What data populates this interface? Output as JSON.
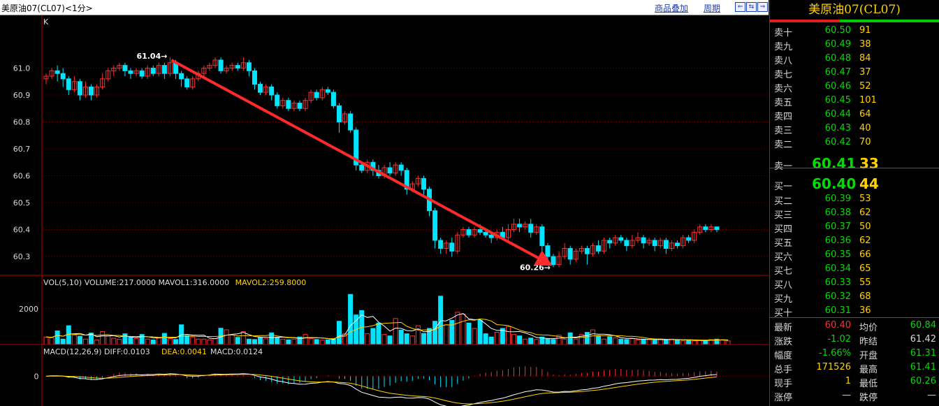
{
  "topbar": {
    "title": "美原油07(CL07)<1分>",
    "overlay_link": "商品叠加",
    "period_link": "周期",
    "nav_buttons": [
      "⇐",
      "⇆",
      "⇒"
    ]
  },
  "chart_data": [
    {
      "type": "candlestick",
      "label": "K",
      "ylim": [
        60.23,
        61.17
      ],
      "yticks": [
        "61.0",
        "60.9",
        "60.8",
        "60.7",
        "60.6",
        "60.5",
        "60.4",
        "60.3"
      ],
      "annotations": [
        {
          "text": "61.04→",
          "value": 61.04
        },
        {
          "text": "60.26→",
          "value": 60.26
        }
      ],
      "candles": [
        [
          60.96,
          60.97,
          60.94,
          60.98
        ],
        [
          60.97,
          60.99,
          60.96,
          61.0
        ],
        [
          60.99,
          60.98,
          60.95,
          61.01
        ],
        [
          60.98,
          60.96,
          60.93,
          61.0
        ],
        [
          60.96,
          60.92,
          60.9,
          60.97
        ],
        [
          60.92,
          60.95,
          60.91,
          60.97
        ],
        [
          60.95,
          60.9,
          60.88,
          60.96
        ],
        [
          60.9,
          60.93,
          60.89,
          60.95
        ],
        [
          60.93,
          60.9,
          60.88,
          60.94
        ],
        [
          60.9,
          60.93,
          60.89,
          60.94
        ],
        [
          60.93,
          60.96,
          60.92,
          60.98
        ],
        [
          60.96,
          60.99,
          60.95,
          61.0
        ],
        [
          60.99,
          61.0,
          60.97,
          61.01
        ],
        [
          61.0,
          61.01,
          60.99,
          61.02
        ],
        [
          61.01,
          60.99,
          60.97,
          61.02
        ],
        [
          60.99,
          60.98,
          60.96,
          61.0
        ],
        [
          60.98,
          60.99,
          60.97,
          61.0
        ],
        [
          60.99,
          60.97,
          60.96,
          61.0
        ],
        [
          60.97,
          61.0,
          60.96,
          61.01
        ],
        [
          61.0,
          60.98,
          60.97,
          61.01
        ],
        [
          60.98,
          61.01,
          60.97,
          61.02
        ],
        [
          61.01,
          60.98,
          60.96,
          61.02
        ],
        [
          60.98,
          61.02,
          60.97,
          61.04
        ],
        [
          61.02,
          60.98,
          60.96,
          61.03
        ],
        [
          60.98,
          60.96,
          60.93,
          60.99
        ],
        [
          60.96,
          60.93,
          60.92,
          60.97
        ],
        [
          60.93,
          60.96,
          60.92,
          60.97
        ],
        [
          60.96,
          60.98,
          60.95,
          60.99
        ],
        [
          60.98,
          61.0,
          60.97,
          61.01
        ],
        [
          61.0,
          61.01,
          60.99,
          61.02
        ],
        [
          61.01,
          61.03,
          61.0,
          61.04
        ],
        [
          61.03,
          60.99,
          60.98,
          61.04
        ],
        [
          60.99,
          61.0,
          60.98,
          61.01
        ],
        [
          61.0,
          61.01,
          60.99,
          61.02
        ],
        [
          61.01,
          61.0,
          60.99,
          61.02
        ],
        [
          61.0,
          61.02,
          60.99,
          61.04
        ],
        [
          61.02,
          60.99,
          60.97,
          61.03
        ],
        [
          60.99,
          60.94,
          60.92,
          61.0
        ],
        [
          60.94,
          60.91,
          60.9,
          60.95
        ],
        [
          60.91,
          60.93,
          60.9,
          60.94
        ],
        [
          60.93,
          60.9,
          60.88,
          60.94
        ],
        [
          60.9,
          60.86,
          60.85,
          60.91
        ],
        [
          60.86,
          60.88,
          60.85,
          60.89
        ],
        [
          60.88,
          60.85,
          60.84,
          60.89
        ],
        [
          60.85,
          60.87,
          60.84,
          60.88
        ],
        [
          60.87,
          60.85,
          60.84,
          60.88
        ],
        [
          60.85,
          60.88,
          60.84,
          60.89
        ],
        [
          60.88,
          60.91,
          60.87,
          60.92
        ],
        [
          60.91,
          60.89,
          60.88,
          60.92
        ],
        [
          60.89,
          60.92,
          60.88,
          60.93
        ],
        [
          60.92,
          60.91,
          60.9,
          60.93
        ],
        [
          60.91,
          60.86,
          60.85,
          60.92
        ],
        [
          60.86,
          60.8,
          60.76,
          60.87
        ],
        [
          60.8,
          60.83,
          60.79,
          60.84
        ],
        [
          60.83,
          60.77,
          60.76,
          60.84
        ],
        [
          60.77,
          60.64,
          60.62,
          60.78
        ],
        [
          60.64,
          60.62,
          60.61,
          60.65
        ],
        [
          60.62,
          60.65,
          60.61,
          60.66
        ],
        [
          60.65,
          60.62,
          60.6,
          60.66
        ],
        [
          60.62,
          60.6,
          60.59,
          60.64
        ],
        [
          60.6,
          60.63,
          60.59,
          60.64
        ],
        [
          60.63,
          60.61,
          60.6,
          60.65
        ],
        [
          60.61,
          60.64,
          60.6,
          60.65
        ],
        [
          60.64,
          60.62,
          60.6,
          60.65
        ],
        [
          60.62,
          60.55,
          60.53,
          60.63
        ],
        [
          60.55,
          60.57,
          60.54,
          60.58
        ],
        [
          60.57,
          60.59,
          60.56,
          60.6
        ],
        [
          60.59,
          60.55,
          60.53,
          60.6
        ],
        [
          60.55,
          60.47,
          60.45,
          60.56
        ],
        [
          60.47,
          60.36,
          60.33,
          60.48
        ],
        [
          60.36,
          60.33,
          60.31,
          60.37
        ],
        [
          60.33,
          60.35,
          60.31,
          60.36
        ],
        [
          60.35,
          60.32,
          60.3,
          60.37
        ],
        [
          60.32,
          60.38,
          60.31,
          60.39
        ],
        [
          60.38,
          60.4,
          60.37,
          60.41
        ],
        [
          60.4,
          60.38,
          60.37,
          60.41
        ],
        [
          60.38,
          60.4,
          60.37,
          60.41
        ],
        [
          60.4,
          60.39,
          60.38,
          60.42
        ],
        [
          60.39,
          60.38,
          60.37,
          60.4
        ],
        [
          60.38,
          60.37,
          60.35,
          60.39
        ],
        [
          60.37,
          60.39,
          60.36,
          60.4
        ],
        [
          60.39,
          60.37,
          60.36,
          60.41
        ],
        [
          60.37,
          60.4,
          60.36,
          60.42
        ],
        [
          60.4,
          60.42,
          60.39,
          60.44
        ],
        [
          60.42,
          60.41,
          60.39,
          60.44
        ],
        [
          60.41,
          60.42,
          60.4,
          60.43
        ],
        [
          60.42,
          60.39,
          60.37,
          60.44
        ],
        [
          60.39,
          60.41,
          60.38,
          60.42
        ],
        [
          60.41,
          60.34,
          60.32,
          60.42
        ],
        [
          60.34,
          60.3,
          60.28,
          60.35
        ],
        [
          60.3,
          60.27,
          60.26,
          60.31
        ],
        [
          60.27,
          60.3,
          60.26,
          60.32
        ],
        [
          60.3,
          60.33,
          60.29,
          60.35
        ],
        [
          60.33,
          60.29,
          60.27,
          60.34
        ],
        [
          60.29,
          60.32,
          60.28,
          60.33
        ],
        [
          60.32,
          60.33,
          60.31,
          60.34
        ],
        [
          60.33,
          60.31,
          60.27,
          60.34
        ],
        [
          60.31,
          60.34,
          60.3,
          60.35
        ],
        [
          60.34,
          60.32,
          60.31,
          60.36
        ],
        [
          60.32,
          60.36,
          60.31,
          60.37
        ],
        [
          60.36,
          60.35,
          60.33,
          60.37
        ],
        [
          60.35,
          60.37,
          60.34,
          60.38
        ],
        [
          60.37,
          60.36,
          60.35,
          60.38
        ],
        [
          60.36,
          60.34,
          60.32,
          60.37
        ],
        [
          60.34,
          60.36,
          60.33,
          60.38
        ],
        [
          60.36,
          60.37,
          60.35,
          60.39
        ],
        [
          60.37,
          60.35,
          60.33,
          60.38
        ],
        [
          60.35,
          60.36,
          60.34,
          60.37
        ],
        [
          60.36,
          60.34,
          60.32,
          60.37
        ],
        [
          60.34,
          60.36,
          60.33,
          60.37
        ],
        [
          60.36,
          60.33,
          60.31,
          60.37
        ],
        [
          60.33,
          60.35,
          60.32,
          60.36
        ],
        [
          60.35,
          60.34,
          60.33,
          60.36
        ],
        [
          60.34,
          60.37,
          60.33,
          60.38
        ],
        [
          60.37,
          60.36,
          60.35,
          60.38
        ],
        [
          60.36,
          60.39,
          60.35,
          60.4
        ],
        [
          60.39,
          60.41,
          60.38,
          60.42
        ],
        [
          60.41,
          60.4,
          60.39,
          60.42
        ],
        [
          60.4,
          60.41,
          60.39,
          60.42
        ],
        [
          60.41,
          60.4,
          60.39,
          60.41
        ]
      ]
    },
    {
      "type": "bar",
      "label": "VOL(5,10)",
      "header": [
        {
          "text": "VOL(5,10) VOLUME:217.0000 MAVOL1:316.0000",
          "color": "#dddddd"
        },
        {
          "text": "MAVOL2:259.8000",
          "color": "#ffd200"
        }
      ],
      "yticks": [
        "2000"
      ],
      "ylim": [
        0,
        3200
      ],
      "values": [
        420,
        380,
        760,
        300,
        1050,
        520,
        460,
        300,
        640,
        260,
        720,
        480,
        350,
        290,
        600,
        410,
        330,
        560,
        300,
        250,
        380,
        620,
        330,
        280,
        1100,
        500,
        420,
        300,
        300,
        260,
        330,
        910,
        820,
        520,
        400,
        720,
        300,
        280,
        410,
        320,
        650,
        380,
        300,
        260,
        300,
        420,
        560,
        320,
        280,
        240,
        260,
        300,
        1300,
        600,
        2800,
        1650,
        1900,
        600,
        900,
        1200,
        560,
        480,
        1450,
        800,
        600,
        480,
        1050,
        620,
        900,
        1300,
        2700,
        1100,
        1350,
        1800,
        1700,
        1200,
        900,
        1350,
        600,
        420,
        680,
        900,
        1000,
        560,
        480,
        300,
        360,
        280,
        420,
        300,
        280,
        520,
        300,
        650,
        300,
        560,
        680,
        820,
        500,
        300,
        440,
        380,
        300,
        280,
        330,
        260,
        300,
        280,
        240,
        280,
        260,
        300,
        240,
        200,
        260,
        200,
        240,
        220,
        280,
        300,
        260,
        200
      ]
    },
    {
      "type": "bar",
      "label": "MACD(12,26,9)",
      "header": [
        {
          "text": "MACD(12,26,9) DIFF:0.0103",
          "color": "#dddddd"
        },
        {
          "text": "DEA:0.0041",
          "color": "#ffd200"
        },
        {
          "text": "MACD:0.0124",
          "color": "#dddddd"
        }
      ],
      "yticks": [
        "0"
      ],
      "ylim": [
        -0.12,
        0.08
      ]
    }
  ],
  "orderbook": {
    "title": "美原油07(CL07)",
    "asks": [
      {
        "label": "卖十",
        "price": "60.50",
        "vol": "91"
      },
      {
        "label": "卖九",
        "price": "60.49",
        "vol": "38"
      },
      {
        "label": "卖八",
        "price": "60.48",
        "vol": "84"
      },
      {
        "label": "卖七",
        "price": "60.47",
        "vol": "37"
      },
      {
        "label": "卖六",
        "price": "60.46",
        "vol": "52"
      },
      {
        "label": "卖五",
        "price": "60.45",
        "vol": "101"
      },
      {
        "label": "卖四",
        "price": "60.44",
        "vol": "64"
      },
      {
        "label": "卖三",
        "price": "60.43",
        "vol": "40"
      },
      {
        "label": "卖二",
        "price": "60.42",
        "vol": "70"
      },
      {
        "label": "卖一",
        "price": "60.41",
        "vol": "33"
      }
    ],
    "bids": [
      {
        "label": "买一",
        "price": "60.40",
        "vol": "44"
      },
      {
        "label": "买二",
        "price": "60.39",
        "vol": "53"
      },
      {
        "label": "买三",
        "price": "60.38",
        "vol": "62"
      },
      {
        "label": "买四",
        "price": "60.37",
        "vol": "50"
      },
      {
        "label": "买五",
        "price": "60.36",
        "vol": "62"
      },
      {
        "label": "买六",
        "price": "60.35",
        "vol": "66"
      },
      {
        "label": "买七",
        "price": "60.34",
        "vol": "65"
      },
      {
        "label": "买八",
        "price": "60.33",
        "vol": "55"
      },
      {
        "label": "买九",
        "price": "60.32",
        "vol": "68"
      },
      {
        "label": "买十",
        "price": "60.31",
        "vol": "36"
      }
    ]
  },
  "stats": [
    {
      "l1": "最新",
      "v1": "60.40",
      "c1": "#ff3030",
      "l2": "均价",
      "v2": "60.84",
      "c2": "#00dd00"
    },
    {
      "l1": "涨跌",
      "v1": "-1.02",
      "c1": "#00dd00",
      "l2": "昨结",
      "v2": "61.42",
      "c2": "#d8d8d8"
    },
    {
      "l1": "幅度",
      "v1": "-1.66%",
      "c1": "#00dd00",
      "l2": "开盘",
      "v2": "61.31",
      "c2": "#00dd00"
    },
    {
      "l1": "总手",
      "v1": "171526",
      "c1": "#ffd200",
      "l2": "最高",
      "v2": "61.41",
      "c2": "#00dd00"
    },
    {
      "l1": "现手",
      "v1": "1",
      "c1": "#ffd200",
      "l2": "最低",
      "v2": "60.26",
      "c2": "#00dd00"
    },
    {
      "l1": "涨停",
      "v1": "—",
      "c1": "#d8d8d8",
      "l2": "跌停",
      "v2": "—",
      "c2": "#d8d8d8"
    }
  ],
  "colors": {
    "up": "#ff3030",
    "down": "#00e5ff",
    "grid": "#7a0000",
    "trend_arrow": "#ff2a2a",
    "ma_white": "#ffffff",
    "ma_yellow": "#ffd200"
  }
}
